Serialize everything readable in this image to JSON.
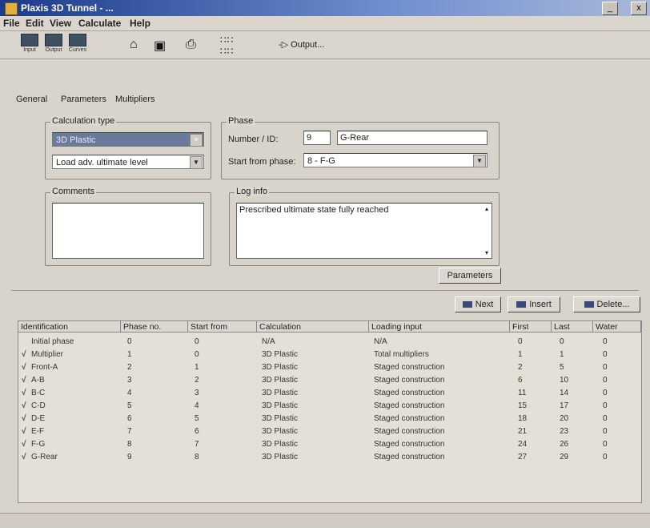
{
  "window": {
    "title": "Plaxis 3D Tunnel - ..."
  },
  "menu": [
    "File",
    "Edit",
    "View",
    "Calculate",
    "Help"
  ],
  "toolbar": {
    "input_label": "Input",
    "output_label": "Output",
    "curves_label": "Curves",
    "output_link": "-▷ Output..."
  },
  "tabs": [
    "General",
    "Parameters",
    "Multipliers"
  ],
  "calculation_type": {
    "legend": "Calculation type",
    "type_value": "3D Plastic",
    "loading_value": "Load adv. ultimate level"
  },
  "phase": {
    "legend": "Phase",
    "number_label": "Number / ID:",
    "number_value": "9",
    "id_value": "G-Rear",
    "start_label": "Start from phase:",
    "start_value": "8 - F-G"
  },
  "comments": {
    "legend": "Comments",
    "value": ""
  },
  "log_info": {
    "legend": "Log info",
    "text": "Prescribed ultimate state fully reached"
  },
  "buttons": {
    "parameters": "Parameters",
    "next": "Next",
    "insert": "Insert",
    "delete": "Delete..."
  },
  "table": {
    "headers": [
      "Identification",
      "Phase no.",
      "Start from",
      "Calculation",
      "Loading input",
      "First",
      "Last",
      "Water"
    ],
    "rows": [
      {
        "check": "",
        "id": "Initial phase",
        "phase": "0",
        "start": "0",
        "calc": "N/A",
        "loading": "N/A",
        "first": "0",
        "last": "0",
        "water": "0"
      },
      {
        "check": "√",
        "id": "Multiplier",
        "phase": "1",
        "start": "0",
        "calc": "3D Plastic",
        "loading": "Total multipliers",
        "first": "1",
        "last": "1",
        "water": "0"
      },
      {
        "check": "√",
        "id": "Front-A",
        "phase": "2",
        "start": "1",
        "calc": "3D Plastic",
        "loading": "Staged construction",
        "first": "2",
        "last": "5",
        "water": "0"
      },
      {
        "check": "√",
        "id": "A-B",
        "phase": "3",
        "start": "2",
        "calc": "3D Plastic",
        "loading": "Staged construction",
        "first": "6",
        "last": "10",
        "water": "0"
      },
      {
        "check": "√",
        "id": "B-C",
        "phase": "4",
        "start": "3",
        "calc": "3D Plastic",
        "loading": "Staged construction",
        "first": "11",
        "last": "14",
        "water": "0"
      },
      {
        "check": "√",
        "id": "C-D",
        "phase": "5",
        "start": "4",
        "calc": "3D Plastic",
        "loading": "Staged construction",
        "first": "15",
        "last": "17",
        "water": "0"
      },
      {
        "check": "√",
        "id": "D-E",
        "phase": "6",
        "start": "5",
        "calc": "3D Plastic",
        "loading": "Staged construction",
        "first": "18",
        "last": "20",
        "water": "0"
      },
      {
        "check": "√",
        "id": "E-F",
        "phase": "7",
        "start": "6",
        "calc": "3D Plastic",
        "loading": "Staged construction",
        "first": "21",
        "last": "23",
        "water": "0"
      },
      {
        "check": "√",
        "id": "F-G",
        "phase": "8",
        "start": "7",
        "calc": "3D Plastic",
        "loading": "Staged construction",
        "first": "24",
        "last": "26",
        "water": "0"
      },
      {
        "check": "√",
        "id": "G-Rear",
        "phase": "9",
        "start": "8",
        "calc": "3D Plastic",
        "loading": "Staged construction",
        "first": "27",
        "last": "29",
        "water": "0"
      }
    ]
  }
}
